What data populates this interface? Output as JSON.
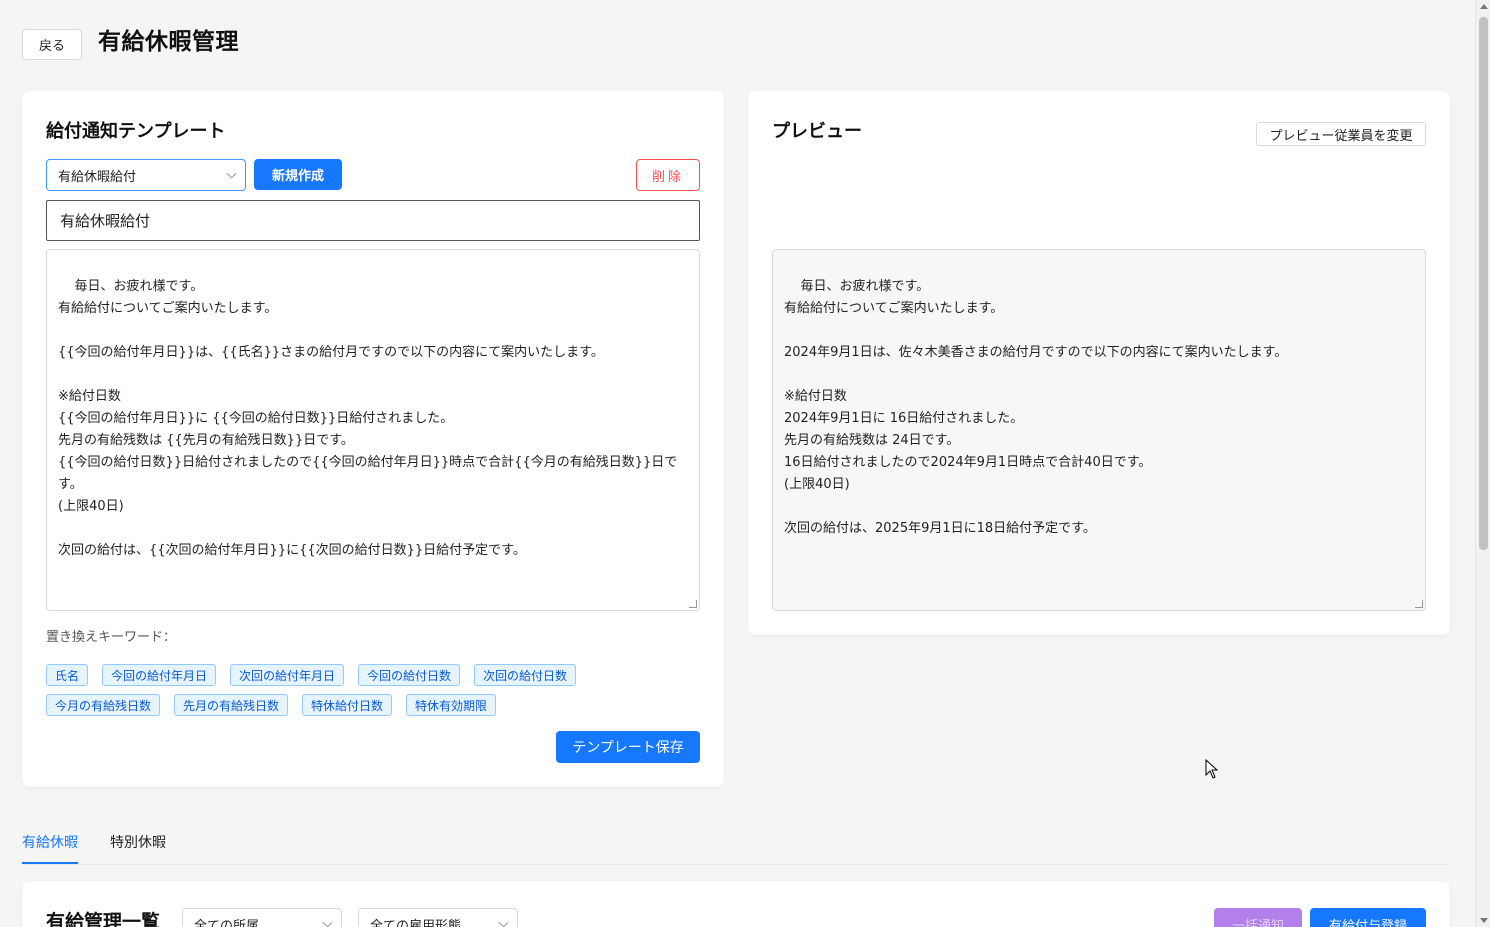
{
  "header": {
    "back_label": "戻る",
    "title": "有給休暇管理"
  },
  "template_card": {
    "title": "給付通知テンプレート",
    "selected_template": "有給休暇給付",
    "new_label": "新規作成",
    "delete_label": "削除",
    "name_value": "有給休暇給付",
    "body_text": "毎日、お疲れ様です。\n有給給付についてご案内いたします。\n\n{{今回の給付年月日}}は、{{氏名}}さまの給付月ですので以下の内容にて案内いたします。\n\n※給付日数\n{{今回の給付年月日}}に {{今回の給付日数}}日給付されました。\n先月の有給残数は {{先月の有給残日数}}日です。\n{{今回の給付日数}}日給付されましたので{{今回の給付年月日}}時点で合計{{今月の有給残日数}}日です。\n(上限40日)\n\n次回の給付は、{{次回の給付年月日}}に{{次回の給付日数}}日給付予定です。",
    "keywords_label": "置き換えキーワード：",
    "keywords": [
      "氏名",
      "今回の給付年月日",
      "次回の給付年月日",
      "今回の給付日数",
      "次回の給付日数",
      "今月の有給残日数",
      "先月の有給残日数",
      "特休給付日数",
      "特休有効期限"
    ],
    "save_label": "テンプレート保存"
  },
  "preview_card": {
    "title": "プレビュー",
    "change_employee_label": "プレビュー従業員を変更",
    "body_text": "毎日、お疲れ様です。\n有給給付についてご案内いたします。\n\n2024年9月1日は、佐々木美香さまの給付月ですので以下の内容にて案内いたします。\n\n※給付日数\n2024年9月1日に 16日給付されました。\n先月の有給残数は 24日です。\n16日給付されましたので2024年9月1日時点で合計40日です。\n(上限40日)\n\n次回の給付は、2025年9月1日に18日給付予定です。"
  },
  "tabs": [
    {
      "label": "有給休暇",
      "active": true
    },
    {
      "label": "特別休暇",
      "active": false
    }
  ],
  "list_card": {
    "title": "有給管理一覧",
    "filter_department": "全ての所属",
    "filter_employment": "全ての雇用形態",
    "bulk_notify_label": "一括通知",
    "register_label": "有給付与登録"
  },
  "colors": {
    "primary": "#1677ff",
    "danger": "#ff4d4f",
    "tag_bg": "#e6f4ff",
    "bulk_disabled": "#b37feb"
  }
}
